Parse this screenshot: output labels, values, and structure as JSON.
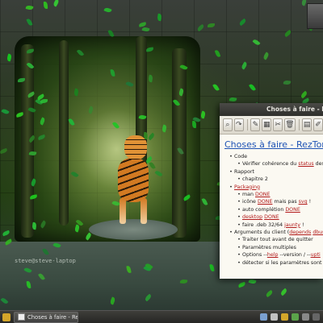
{
  "desktop": {
    "user_host": "steve@steve-laptop"
  },
  "window": {
    "title": "Choses à faire - RezTorrent",
    "toolbar_icons": [
      "zoom-icon",
      "redo-icon",
      "pin-icon",
      "grid-icon",
      "cut-icon",
      "trash-icon",
      "note-icon",
      "edit-icon"
    ],
    "doc_title": "Choses à faire - RezTorrent",
    "tree": [
      {
        "level": 1,
        "parts": [
          {
            "t": "Code"
          }
        ]
      },
      {
        "level": 2,
        "parts": [
          {
            "t": "Vérifier cohérence du "
          },
          {
            "t": "status",
            "link": true
          },
          {
            "t": " des"
          }
        ]
      },
      {
        "level": 1,
        "parts": [
          {
            "t": "Rapport"
          }
        ]
      },
      {
        "level": 2,
        "parts": [
          {
            "t": "chapitre 2"
          }
        ]
      },
      {
        "level": 1,
        "parts": [
          {
            "t": "Packaging",
            "link": true
          }
        ]
      },
      {
        "level": 2,
        "parts": [
          {
            "t": "man "
          },
          {
            "t": "DONE",
            "link": true
          }
        ]
      },
      {
        "level": 2,
        "parts": [
          {
            "t": "icône "
          },
          {
            "t": "DONE",
            "link": true
          },
          {
            "t": " mais pas "
          },
          {
            "t": "svg",
            "link": true
          },
          {
            "t": " !"
          }
        ]
      },
      {
        "level": 2,
        "parts": [
          {
            "t": "auto complétion "
          },
          {
            "t": "DONE",
            "link": true
          }
        ]
      },
      {
        "level": 2,
        "parts": [
          {
            "t": "desktop",
            "link": true
          },
          {
            "t": " "
          },
          {
            "t": "DONE",
            "link": true
          }
        ]
      },
      {
        "level": 2,
        "parts": [
          {
            "t": "faire .deb 32/64 "
          },
          {
            "t": "jaunty",
            "link": true
          },
          {
            "t": " !"
          }
        ]
      },
      {
        "level": 1,
        "parts": [
          {
            "t": "Arguments du client ("
          },
          {
            "t": "depends",
            "link": true
          },
          {
            "t": " "
          },
          {
            "t": "dbus",
            "link": true
          }
        ]
      },
      {
        "level": 2,
        "parts": [
          {
            "t": "Traiter tout avant de quitter"
          }
        ]
      },
      {
        "level": 2,
        "parts": [
          {
            "t": "Paramètres multiples"
          }
        ]
      },
      {
        "level": 2,
        "parts": [
          {
            "t": "Options --"
          },
          {
            "t": "help",
            "link": true
          },
          {
            "t": " --version / --"
          },
          {
            "t": "upti",
            "link": true
          }
        ]
      },
      {
        "level": 2,
        "parts": [
          {
            "t": "détecter si les paramètres sont "
          },
          {
            "t": "p",
            "link": true
          }
        ]
      }
    ]
  },
  "taskbar": {
    "task_label": "Choses à faire - RezT...",
    "colors": {
      "accent": "#d4a62a"
    }
  }
}
